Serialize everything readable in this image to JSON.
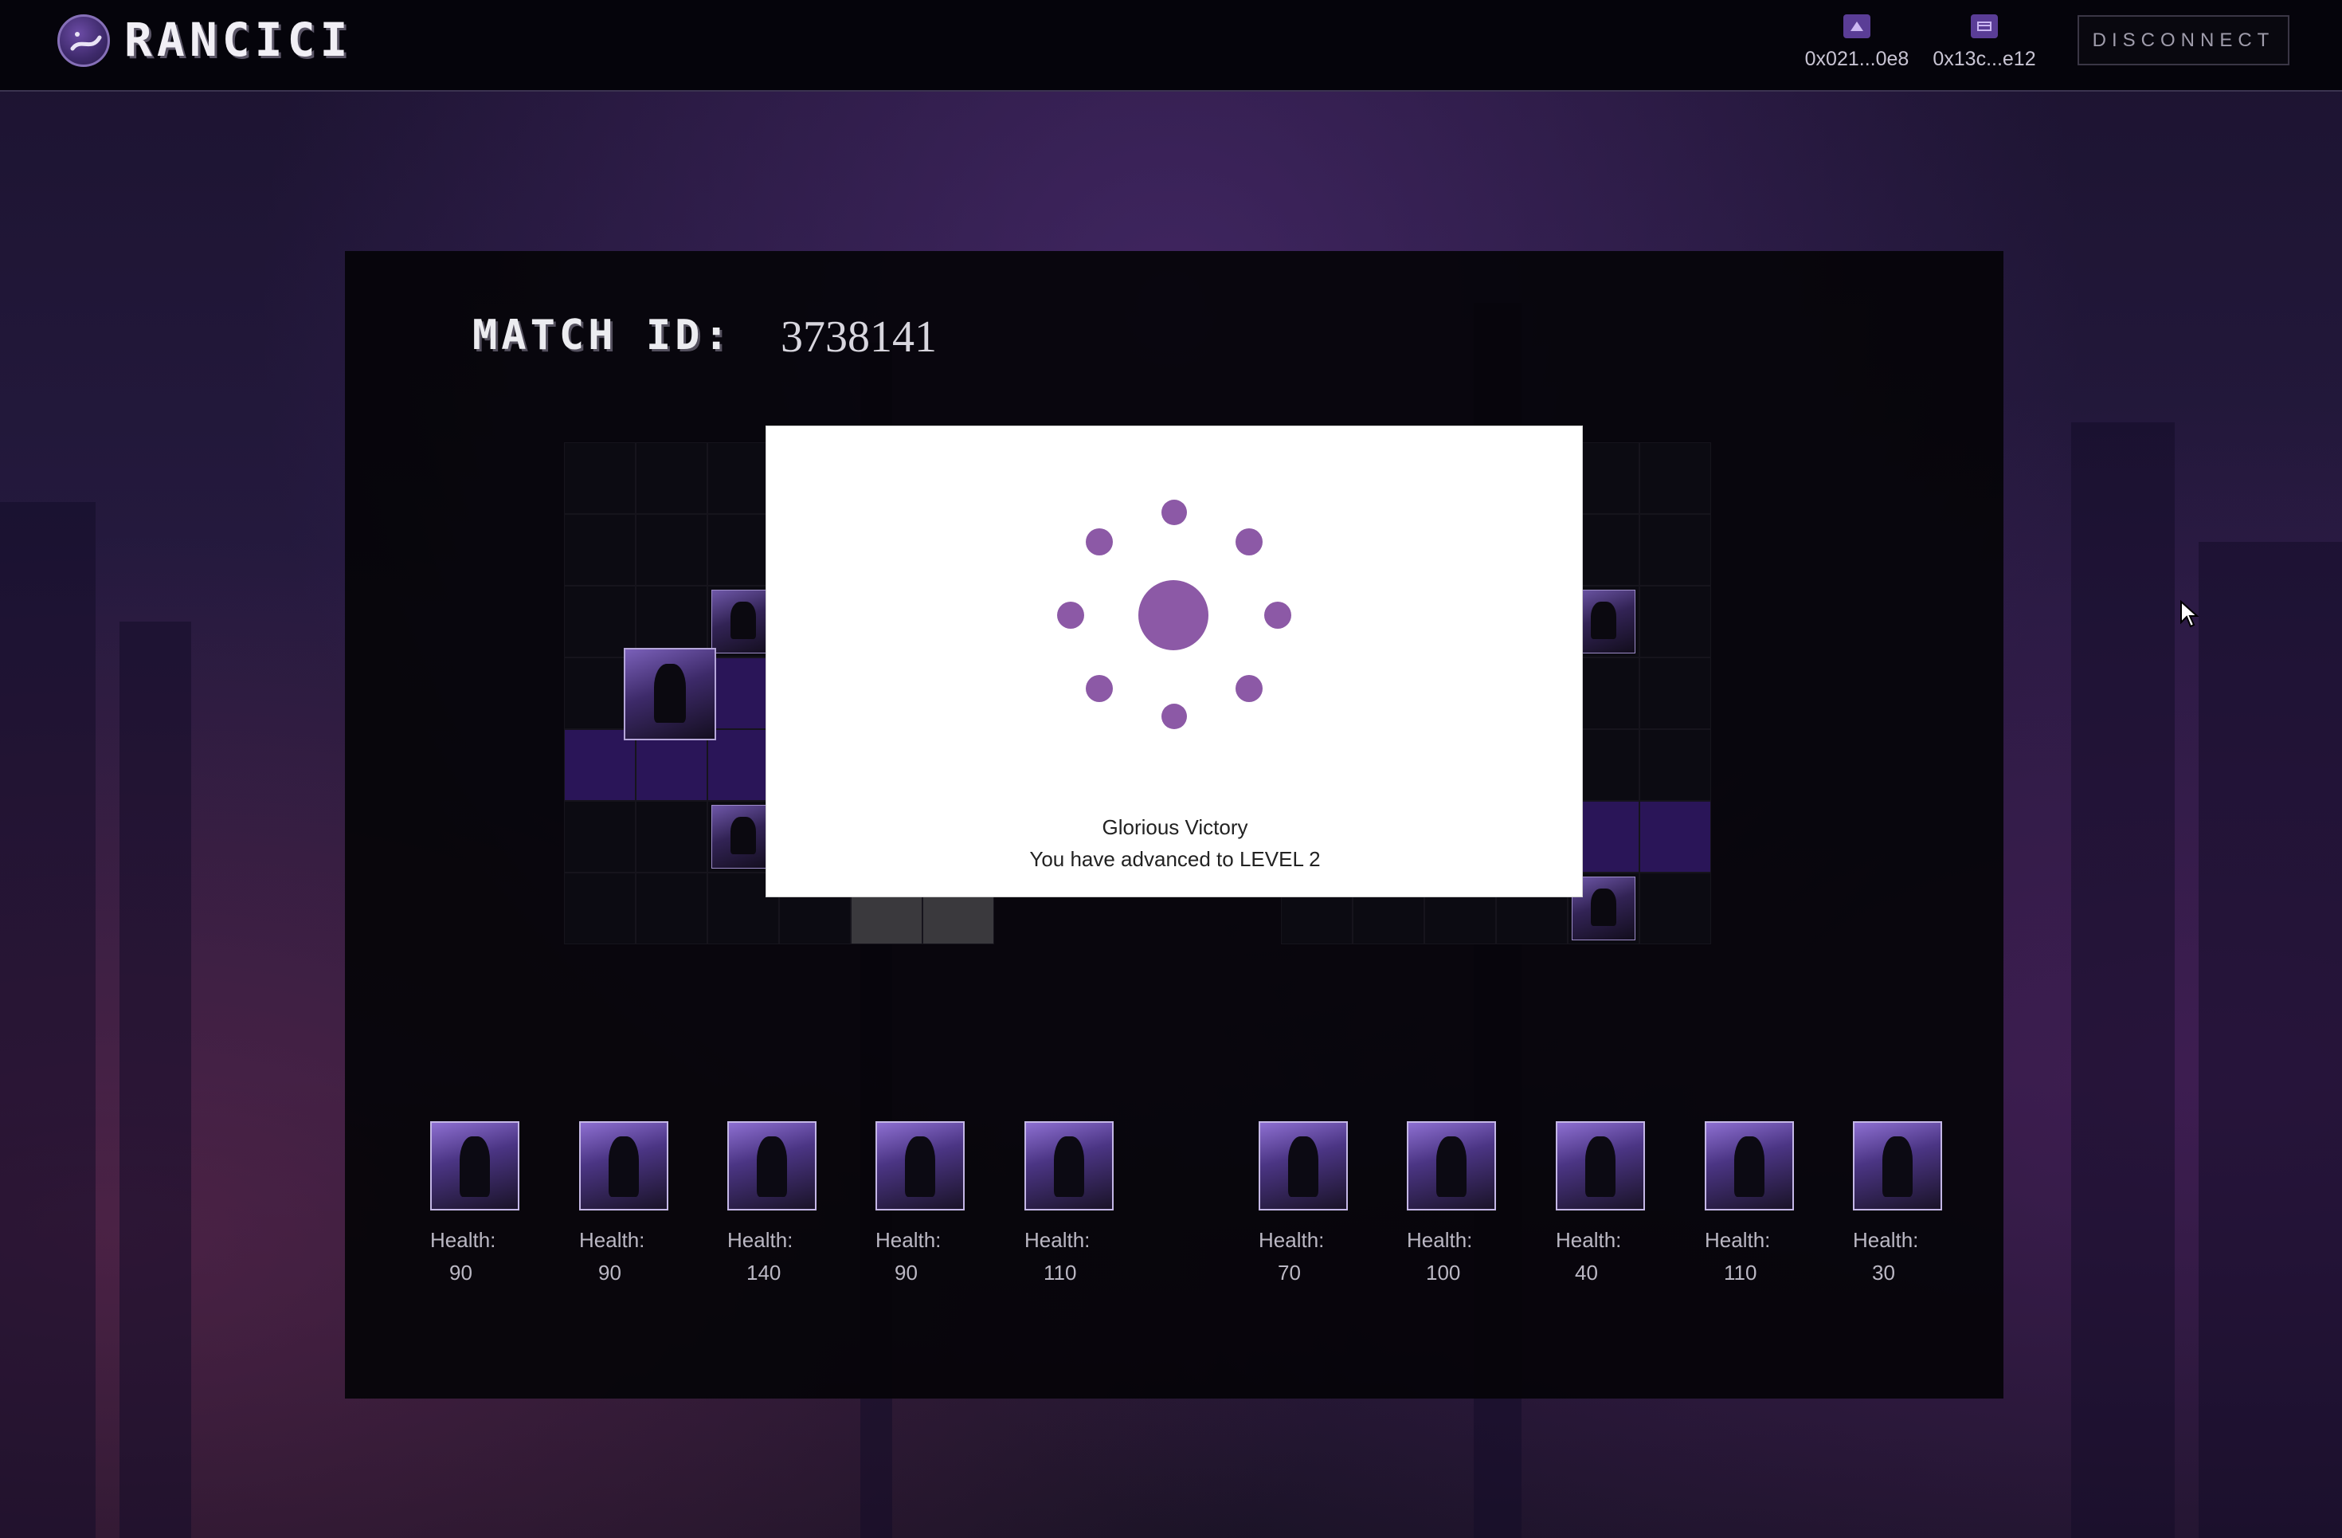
{
  "header": {
    "logo_text": "RANCICI",
    "wallets": [
      {
        "icon": "account-icon",
        "address": "0x021...0e8"
      },
      {
        "icon": "wallet-card-icon",
        "address": "0x13c...e12"
      }
    ],
    "disconnect_label": "DISCONNECT"
  },
  "match": {
    "label": "MATCH ID:",
    "id": "3738141"
  },
  "modal": {
    "title": "Glorious Victory",
    "message": "You have advanced to LEVEL 2"
  },
  "team_left": [
    {
      "health_label": "Health:",
      "health": "90"
    },
    {
      "health_label": "Health:",
      "health": "90"
    },
    {
      "health_label": "Health:",
      "health": "140"
    },
    {
      "health_label": "Health:",
      "health": "90"
    },
    {
      "health_label": "Health:",
      "health": "110"
    }
  ],
  "team_right": [
    {
      "health_label": "Health:",
      "health": "70"
    },
    {
      "health_label": "Health:",
      "health": "100"
    },
    {
      "health_label": "Health:",
      "health": "40"
    },
    {
      "health_label": "Health:",
      "health": "110"
    },
    {
      "health_label": "Health:",
      "health": "30"
    }
  ],
  "colors": {
    "accent": "#8c59a6",
    "highlight_cell": "#2a1558",
    "blocked_cell": "#3a393d"
  }
}
